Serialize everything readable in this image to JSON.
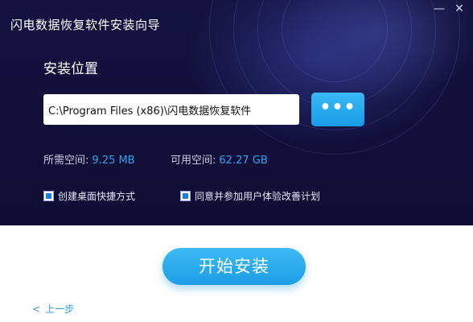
{
  "window": {
    "title": "闪电数据恢复软件安装向导",
    "minimize_glyph": "—",
    "close_glyph": "✕"
  },
  "install_location": {
    "heading": "安装位置",
    "path_value": "C:\\Program Files (x86)\\闪电数据恢复软件",
    "browse_label": "•••"
  },
  "space": {
    "required_label": "所需空间:",
    "required_value": "9.25 MB",
    "available_label": "可用空间:",
    "available_value": "62.27 GB"
  },
  "options": [
    {
      "label": "创建桌面快捷方式",
      "checked": true
    },
    {
      "label": "同意并参加用户体验改善计划",
      "checked": true
    }
  ],
  "actions": {
    "install_label": "开始安装",
    "back_glyph": "<",
    "back_label": "上一步"
  },
  "colors": {
    "header_bg": "#120f3a",
    "accent_blue": "#1a9de8",
    "value_blue": "#2aa6ef"
  }
}
